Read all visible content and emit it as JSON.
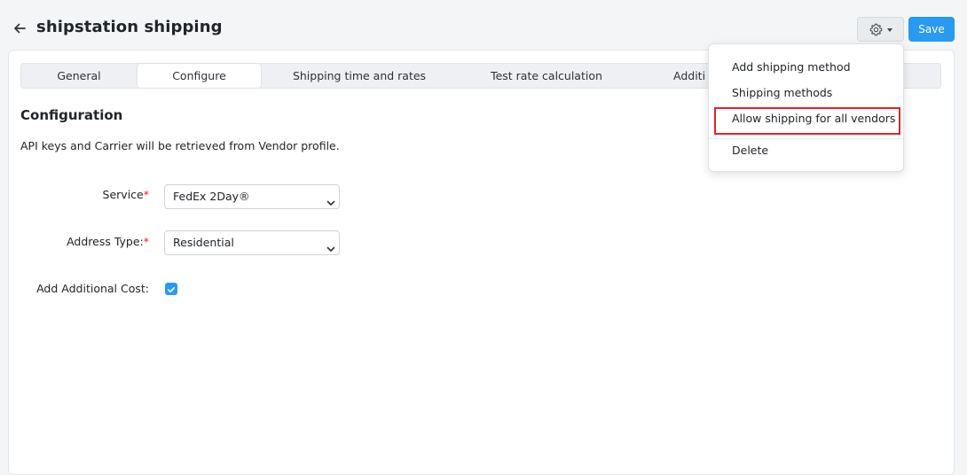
{
  "header": {
    "title": "shipstation shipping",
    "back_icon": "arrow-left-icon",
    "settings_icon": "gear-icon",
    "save_label": "Save"
  },
  "tabs": [
    {
      "label": "General",
      "active": false
    },
    {
      "label": "Configure",
      "active": true
    },
    {
      "label": "Shipping time and rates",
      "active": false
    },
    {
      "label": "Test rate calculation",
      "active": false
    },
    {
      "label": "Additi",
      "active": false
    }
  ],
  "configuration": {
    "title": "Configuration",
    "description": "API keys and Carrier will be retrieved from Vendor profile.",
    "service": {
      "label": "Service",
      "required_mark": "*",
      "value": "FedEx 2Day®"
    },
    "address_type": {
      "label": "Address Type:",
      "required_mark": "*",
      "value": "Residential"
    },
    "additional_cost": {
      "label": "Add Additional Cost:",
      "checked": true
    }
  },
  "dropdown_menu": {
    "items": [
      {
        "label": "Add shipping method"
      },
      {
        "label": "Shipping methods"
      },
      {
        "label": "Allow shipping for all vendors",
        "highlighted": true
      },
      {
        "label": "Delete"
      }
    ]
  },
  "colors": {
    "accent": "#2a9af0",
    "highlight_border": "#d9262c",
    "required": "#d9262c"
  }
}
